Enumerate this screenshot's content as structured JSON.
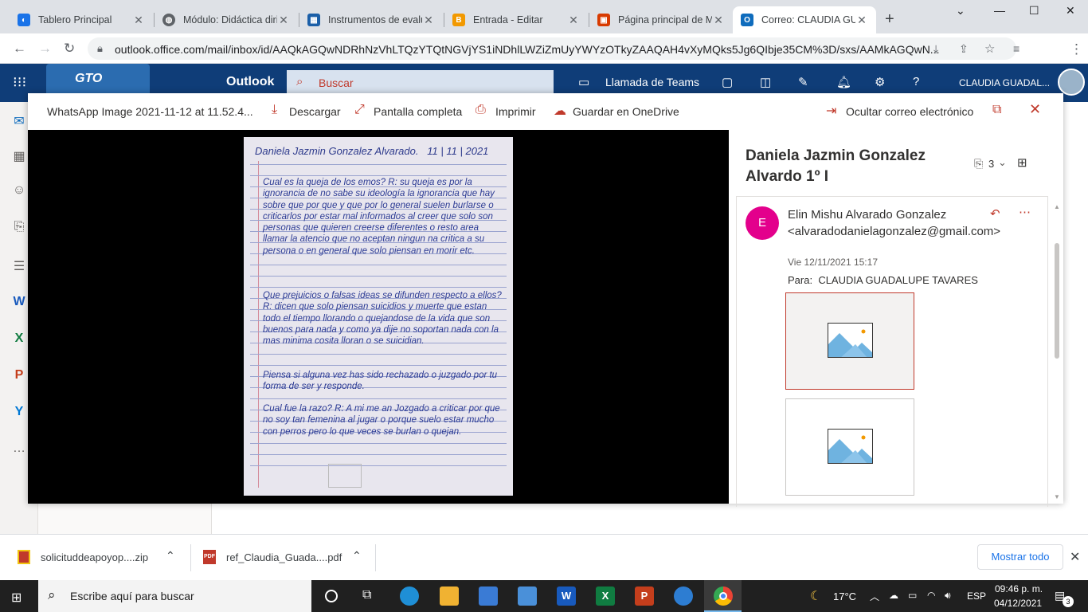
{
  "browser": {
    "tabs": [
      {
        "label": "Tablero Principal",
        "color": "#1a73e8",
        "glyph": "◐"
      },
      {
        "label": "Módulo: Didáctica dirig",
        "color": "#5f6368",
        "glyph": "◍"
      },
      {
        "label": "Instrumentos de evalua",
        "color": "#1b5fa8",
        "glyph": "▦"
      },
      {
        "label": "Entrada - Editar",
        "color": "#f29900",
        "glyph": "B"
      },
      {
        "label": "Página principal de Mi",
        "color": "#d83b01",
        "glyph": "▣"
      },
      {
        "label": "Correo: CLAUDIA GUAD",
        "color": "#0f6cbd",
        "glyph": "O"
      }
    ],
    "new_tab": "+",
    "url": "outlook.office.com/mail/inbox/id/AAQkAGQwNDRhNzVhLTQzYTQtNGVjYS1iNDhlLWZiZmUyYWYzOTkyZAAQAH4vXyMQks5Jg6QIbje35CM%3D/sxs/AAMkAGQwN..."
  },
  "outlook": {
    "brand": "Outlook",
    "search_placeholder": "Buscar",
    "teams_call": "Llamada de Teams",
    "user": "CLAUDIA GUADAL..."
  },
  "viewer": {
    "filename": "WhatsApp Image 2021-11-12 at 11.52.4...",
    "download": "Descargar",
    "fullscreen": "Pantalla completa",
    "print": "Imprimir",
    "onedrive": "Guardar en OneDrive",
    "hide_mail": "Ocultar correo electrónico"
  },
  "message": {
    "subject": "Daniela Jazmin Gonzalez Alvardo 1º I",
    "attachments_count": "3",
    "avatar_letter": "E",
    "sender": "Elin Mishu Alvarado Gonzalez <alvaradodanielagonzalez@gmail.com>",
    "date": "Vie 12/11/2021 15:17",
    "to_label": "Para:",
    "to": "CLAUDIA GUADALUPE TAVARES"
  },
  "downloads": {
    "items": [
      "solicituddeapoyop....zip",
      "ref_Claudia_Guada....pdf"
    ],
    "show_all": "Mostrar todo"
  },
  "taskbar": {
    "search": "Escribe aquí para buscar",
    "temp": "17°C",
    "lang": "ESP",
    "time": "09:46 p. m.",
    "date": "04/12/2021",
    "notifications": "3"
  }
}
